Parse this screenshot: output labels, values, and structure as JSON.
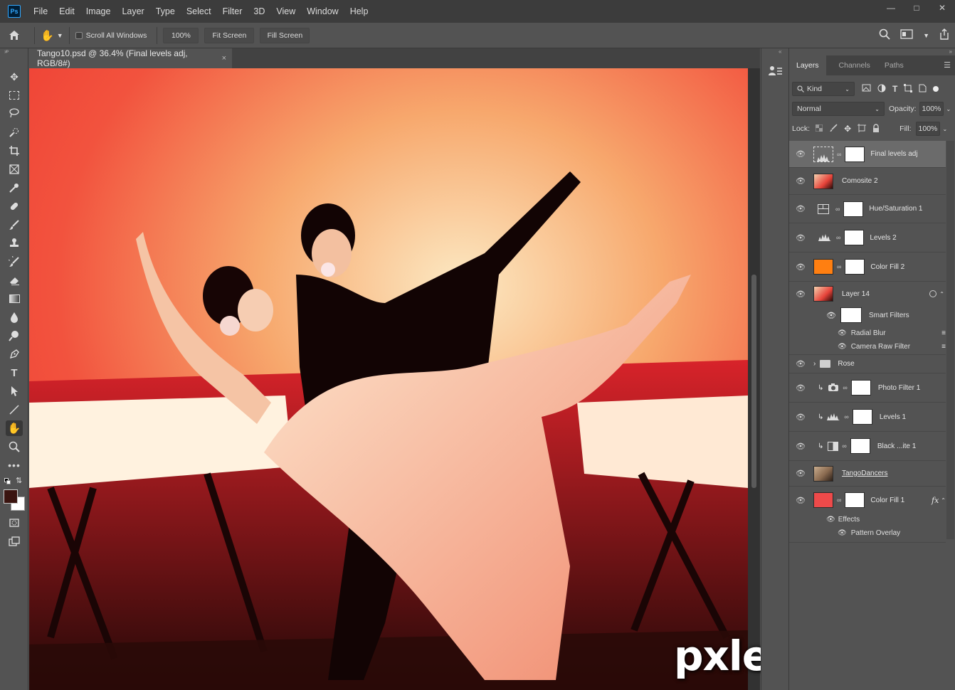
{
  "app": {
    "logo": "Ps"
  },
  "menu": [
    "File",
    "Edit",
    "Image",
    "Layer",
    "Type",
    "Select",
    "Filter",
    "3D",
    "View",
    "Window",
    "Help"
  ],
  "options": {
    "scroll_all": "Scroll All Windows",
    "zoom": "100%",
    "fit_screen": "Fit Screen",
    "fill_screen": "Fill Screen"
  },
  "document": {
    "tab_title": "Tango10.psd @ 36.4% (Final levels adj, RGB/8#)",
    "close": "×"
  },
  "tools": [
    "move-icon",
    "marquee-icon",
    "lasso-icon",
    "quick-select-icon",
    "crop-icon",
    "frame-icon",
    "eyedropper-icon",
    "healing-icon",
    "brush-icon",
    "stamp-icon",
    "history-brush-icon",
    "eraser-icon",
    "gradient-icon",
    "blur-icon",
    "dodge-icon",
    "pen-icon",
    "type-icon",
    "path-select-icon",
    "line-icon",
    "hand-icon",
    "zoom-icon",
    "more-icon"
  ],
  "colors": {
    "foreground": "#3a1410",
    "background": "#ffffff",
    "accent": "#31a8ff"
  },
  "panel": {
    "tabs": [
      "Layers",
      "Channels",
      "Paths"
    ],
    "filter_kind": "Kind",
    "blend_mode": "Normal",
    "opacity_label": "Opacity:",
    "opacity_value": "100%",
    "lock_label": "Lock:",
    "fill_label": "Fill:",
    "fill_value": "100%"
  },
  "layers": [
    {
      "name": "Final levels adj",
      "thumb": "levels",
      "mask": true,
      "selected": true
    },
    {
      "name": "Comosite 2",
      "thumb": "photo",
      "mask": false
    },
    {
      "name": "Hue/Saturation 1",
      "thumb": "huesat",
      "mask": true
    },
    {
      "name": "Levels 2",
      "thumb": "levels",
      "mask": true
    },
    {
      "name": "Color Fill 2",
      "thumb": "orange",
      "mask": true
    },
    {
      "name": "Layer 14",
      "thumb": "photo",
      "mask": false
    },
    {
      "name": "Rose",
      "thumb": "folder",
      "mask": false
    },
    {
      "name": "Photo Filter 1",
      "thumb": "camera",
      "mask": true,
      "clipped": true
    },
    {
      "name": "Levels 1",
      "thumb": "levels",
      "mask": true,
      "clipped": true
    },
    {
      "name": "Black ...ite 1",
      "thumb": "bw",
      "mask": true,
      "clipped": true
    },
    {
      "name": "TangoDancers",
      "thumb": "photo",
      "mask": false
    },
    {
      "name": "Color Fill 1",
      "thumb": "red",
      "mask": true,
      "fx": "fx"
    }
  ],
  "sublayers": {
    "smart_filters": "Smart Filters",
    "radial_blur": "Radial Blur",
    "camera_raw": "Camera Raw Filter",
    "effects": "Effects",
    "pattern_overlay": "Pattern Overlay"
  },
  "watermark": "pxleyes.com"
}
